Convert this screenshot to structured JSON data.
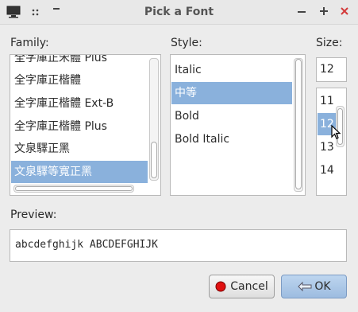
{
  "window": {
    "title": "Pick a Font",
    "minimize_icon": "minimize-icon",
    "maximize_icon": "maximize-icon",
    "close_icon": "close-icon"
  },
  "family": {
    "label": "Family:",
    "items": [
      "全字庫正宋體 Plus",
      "全字庫正楷體",
      "全字庫正楷體 Ext-B",
      "全字庫正楷體 Plus",
      "文泉驛正黑",
      "文泉驛等寬正黑"
    ],
    "selected": "文泉驛等寬正黑"
  },
  "style": {
    "label": "Style:",
    "items": [
      "Italic",
      "中等",
      "Bold",
      "Bold Italic"
    ],
    "selected": "中等"
  },
  "size": {
    "label": "Size:",
    "value": "12",
    "items": [
      "11",
      "12",
      "13",
      "14"
    ],
    "selected": "12"
  },
  "preview": {
    "label": "Preview:",
    "text": "abcdefghijk ABCDEFGHIJK"
  },
  "buttons": {
    "cancel": "Cancel",
    "ok": "OK"
  },
  "colors": {
    "selection": "#8ab1dc",
    "close": "#d33b3b",
    "ok_button": "#a9c6e8"
  }
}
